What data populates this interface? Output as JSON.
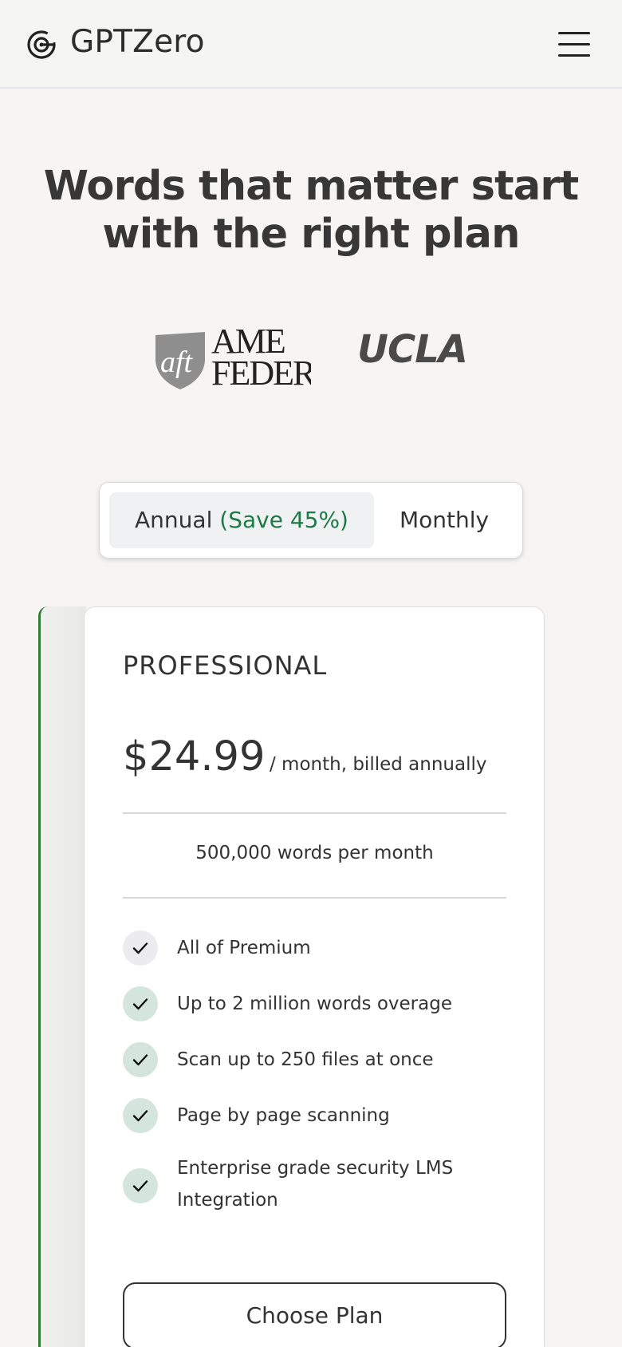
{
  "header": {
    "brand": "GPTZero",
    "logo_icon": "gptzero-logo-icon",
    "menu_icon": "hamburger-menu-icon"
  },
  "hero": {
    "title": "Words that matter start with the right plan"
  },
  "logos": {
    "aft": {
      "mark": "aft",
      "line1": "AME",
      "line2": "FEDER"
    },
    "ucla": "UCLA"
  },
  "billing_toggle": {
    "annual_label": "Annual",
    "annual_save": "(Save 45%)",
    "monthly_label": "Monthly",
    "selected": "annual"
  },
  "plan": {
    "name": "PROFESSIONAL",
    "price": "$24.99",
    "period": "/ month, billed annually",
    "words": "500,000 words per month",
    "features": [
      {
        "text": "All of Premium",
        "icon": "check-icon"
      },
      {
        "text": "Up to 2 million words overage",
        "icon": "check-icon"
      },
      {
        "text": "Scan up to 250 files at once",
        "icon": "check-icon"
      },
      {
        "text": "Page by page scanning",
        "icon": "check-icon"
      },
      {
        "text": "Enterprise grade security LMS Integration",
        "icon": "check-icon"
      }
    ],
    "cta": "Choose Plan"
  },
  "colors": {
    "accent_green": "#1e7a45",
    "border_green": "#2e7d32",
    "check_bg": "#d4e6dc",
    "background": "#f6f5f3"
  }
}
